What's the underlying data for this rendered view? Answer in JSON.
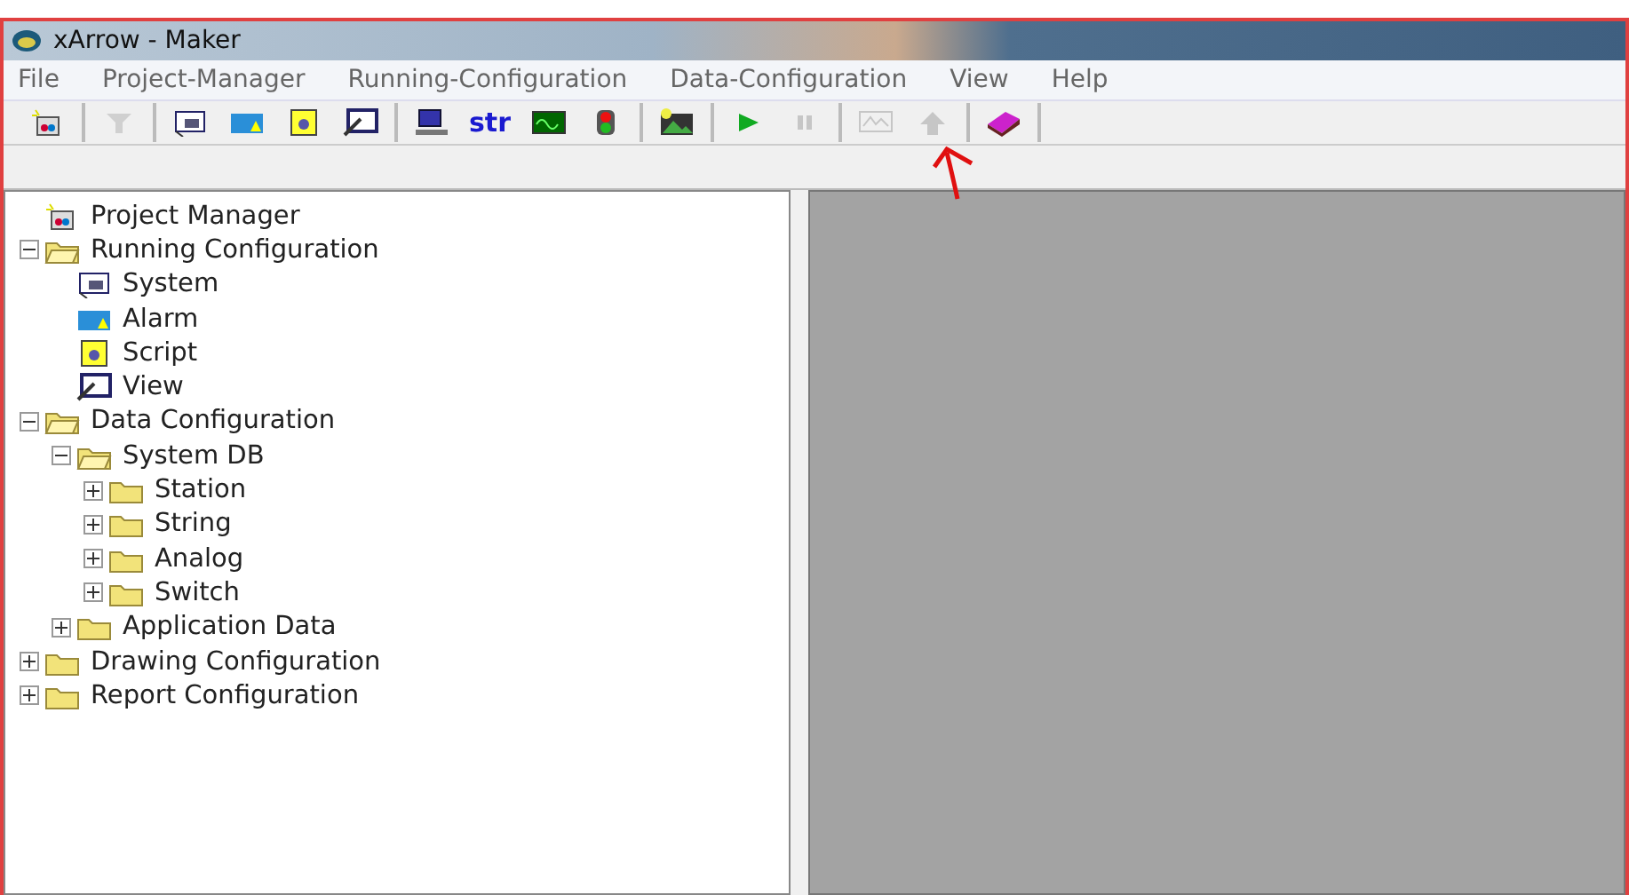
{
  "window": {
    "title": "xArrow - Maker"
  },
  "menu": [
    "File",
    "Project-Manager",
    "Running-Configuration",
    "Data-Configuration",
    "View",
    "Help"
  ],
  "toolbar": [
    [
      {
        "kind": "project",
        "disabled": false
      }
    ],
    [
      {
        "kind": "filter",
        "disabled": true
      }
    ],
    [
      {
        "kind": "system",
        "disabled": false
      },
      {
        "kind": "alarm",
        "disabled": false
      },
      {
        "kind": "script",
        "disabled": false
      },
      {
        "kind": "view",
        "disabled": false
      }
    ],
    [
      {
        "kind": "computer",
        "disabled": false
      },
      {
        "kind": "text",
        "label": "str",
        "disabled": false
      },
      {
        "kind": "monitor",
        "disabled": false
      },
      {
        "kind": "lights",
        "disabled": false
      }
    ],
    [
      {
        "kind": "picture",
        "disabled": false
      }
    ],
    [
      {
        "kind": "play",
        "disabled": false
      },
      {
        "kind": "pause",
        "disabled": true
      }
    ],
    [
      {
        "kind": "chart",
        "disabled": true
      },
      {
        "kind": "upload",
        "disabled": true
      }
    ],
    [
      {
        "kind": "book",
        "disabled": false
      }
    ]
  ],
  "tree": [
    {
      "label": "Project Manager",
      "kind": "project"
    },
    {
      "label": "Running Configuration",
      "kind": "folder",
      "expanded": true,
      "children": [
        {
          "label": "System",
          "kind": "system"
        },
        {
          "label": "Alarm",
          "kind": "alarm"
        },
        {
          "label": "Script",
          "kind": "script"
        },
        {
          "label": "View",
          "kind": "view"
        }
      ]
    },
    {
      "label": "Data Configuration",
      "kind": "folder",
      "expanded": true,
      "children": [
        {
          "label": "System DB",
          "kind": "folder",
          "expanded": true,
          "children": [
            {
              "label": "Station",
              "kind": "folder",
              "expanded": false
            },
            {
              "label": "String",
              "kind": "folder",
              "expanded": false
            },
            {
              "label": "Analog",
              "kind": "folder",
              "expanded": false
            },
            {
              "label": "Switch",
              "kind": "folder",
              "expanded": false
            }
          ]
        },
        {
          "label": "Application Data",
          "kind": "folder",
          "expanded": false
        }
      ]
    },
    {
      "label": "Drawing Configuration",
      "kind": "folder",
      "expanded": false
    },
    {
      "label": "Report Configuration",
      "kind": "folder",
      "expanded": false
    }
  ]
}
